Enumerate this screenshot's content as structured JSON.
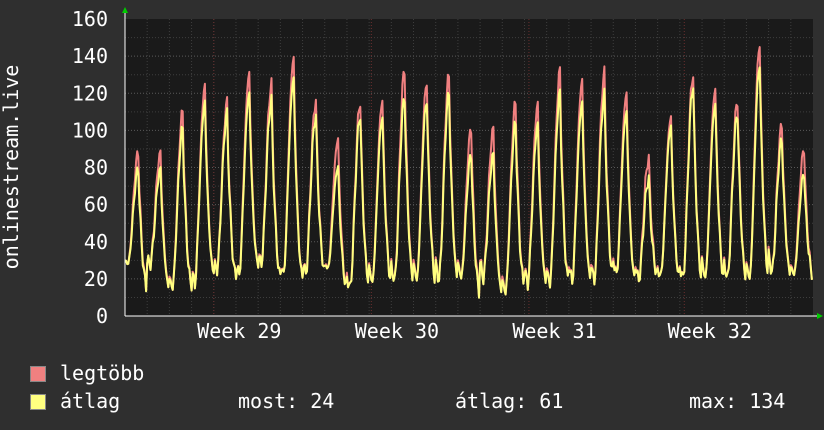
{
  "chart_data": {
    "type": "line",
    "ylabel": "onlinestream.live",
    "ylim": [
      0,
      160
    ],
    "yticks": [
      0,
      20,
      40,
      60,
      80,
      100,
      120,
      140,
      160
    ],
    "x_tick_labels": [
      "Week 29",
      "Week 30",
      "Week 31",
      "Week 32"
    ],
    "grid": true,
    "x_day_range": [
      0,
      31
    ],
    "series": [
      {
        "name": "legtöbb",
        "color": "#f08080",
        "peaks": [
          88,
          110,
          124,
          115,
          131,
          125,
          139,
          116,
          95,
          115,
          116,
          133,
          126,
          130,
          101,
          115,
          114,
          132,
          127,
          131,
          120,
          85,
          107,
          130,
          122,
          116,
          146,
          103,
          90
        ],
        "troughs": [
          28,
          15,
          17,
          24,
          22,
          28,
          22,
          22,
          25,
          15,
          18,
          19,
          19,
          19,
          20,
          12,
          17,
          17,
          18,
          19,
          22,
          19,
          22,
          20,
          20,
          20,
          20,
          23,
          22
        ]
      },
      {
        "name": "átlag",
        "color": "#ffff80",
        "peaks": [
          79,
          101,
          115,
          109,
          120,
          116,
          128,
          108,
          80,
          108,
          107,
          118,
          116,
          120,
          87,
          104,
          103,
          120,
          115,
          119,
          110,
          74,
          102,
          124,
          114,
          109,
          135,
          95,
          77
        ],
        "troughs": [
          28,
          15,
          17,
          24,
          22,
          28,
          22,
          22,
          25,
          15,
          18,
          19,
          19,
          19,
          20,
          12,
          17,
          17,
          18,
          19,
          22,
          19,
          22,
          20,
          20,
          20,
          20,
          23,
          22
        ]
      }
    ]
  },
  "legend": [
    {
      "label": "legtöbb",
      "color": "#f08080"
    },
    {
      "label": "átlag",
      "color": "#ffff80"
    }
  ],
  "stats": {
    "most": "most: 24",
    "atlag": "átlag: 61",
    "max": "max: 134"
  }
}
